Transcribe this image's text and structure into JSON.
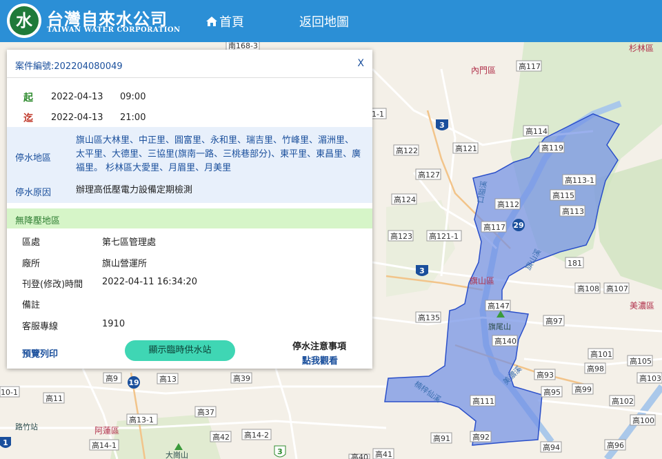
{
  "header": {
    "logo_mark": "水",
    "logo_cn": "台灣自來水公司",
    "logo_en": "TAIWAN WATER CORPORATION",
    "nav_home": "首頁",
    "nav_back": "返回地圖"
  },
  "panel": {
    "case_number": "案件編號:202204080049",
    "close": "X",
    "start_label": "起",
    "start_date": "2022-04-13",
    "start_time": "09:00",
    "end_label": "迄",
    "end_date": "2022-04-13",
    "end_time": "21:00",
    "area_label": "停水地區",
    "area_value": "旗山區大林里、中正里、圓富里、永和里、瑞吉里、竹峰里、湄洲里、太平里、大德里、三協里(旗南一路、三桃巷部分)、東平里、東昌里、廣福里。 杉林區大愛里、月眉里、月美里",
    "reason_label": "停水原因",
    "reason_value": "辦理高低壓電力設備定期檢測",
    "no_pressure_label": "無降壓地區",
    "district_label": "區處",
    "district_value": "第七區管理處",
    "office_label": "廠所",
    "office_value": "旗山營運所",
    "published_label": "刊登(修改)時間",
    "published_value": "2022-04-11 16:34:20",
    "remark_label": "備註",
    "remark_value": "",
    "hotline_label": "客服專線",
    "hotline_value": "1910",
    "print_link": "預覽列印",
    "show_stations_button": "顯示臨時供水站",
    "notice_title": "停水注意事項",
    "notice_link": "點我觀看"
  },
  "map": {
    "district_labels": [
      "杉林區",
      "內門區",
      "旗山區",
      "美濃區",
      "阿蓮區"
    ],
    "mountain_labels": [
      "旗尾山",
      "大崗山"
    ],
    "road_labels": [
      "高117",
      "高114",
      "高119",
      "高121",
      "高122",
      "高127",
      "高113-1",
      "高115",
      "高113",
      "高112",
      "高124",
      "高123",
      "高121-1",
      "高117",
      "181",
      "高108",
      "高107",
      "高147",
      "高135",
      "高97",
      "高140",
      "高101",
      "高105",
      "高98",
      "高93",
      "高103",
      "高99",
      "高95",
      "高102",
      "高100",
      "高111",
      "高92",
      "高91",
      "高94",
      "高96",
      "高9",
      "高13",
      "高39",
      "高11",
      "高37",
      "高13-1",
      "高42",
      "高14-2",
      "高14-1",
      "高41",
      "高40",
      "南168-3",
      "1-1",
      "10-1"
    ],
    "highway_shields": [
      "3",
      "3",
      "29",
      "19",
      "3",
      "1"
    ],
    "river_labels": [
      "旗山溪",
      "美濃溪",
      "口隘溪",
      "楠梓仙溪"
    ],
    "station_label": "路竹站",
    "outage_color": "#6f8fe6",
    "outage_border": "#2a4fc9"
  }
}
